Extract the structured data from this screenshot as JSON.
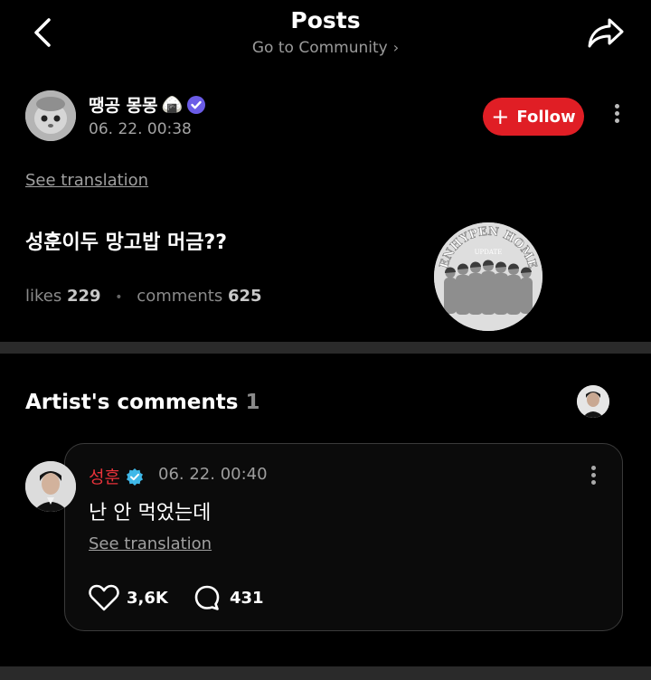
{
  "header": {
    "title": "Posts",
    "subtitle": "Go to Community"
  },
  "post": {
    "author": {
      "name": "땡공 몽몽",
      "badge_emoji": "🍙",
      "date": "06. 22. 00:38"
    },
    "follow_label": "Follow",
    "see_translation": "See translation",
    "text": "성훈이두 망고밥 머금??",
    "likes_label": "likes",
    "likes": "229",
    "comments_label": "comments",
    "comments": "625",
    "thumbnail_lines": [
      "ENHYPEN HOME",
      "UPDATE"
    ]
  },
  "artist_comments": {
    "heading": "Artist's comments",
    "count": "1",
    "comment": {
      "author": "성훈",
      "date": "06. 22. 00:40",
      "text": "난 안 먹었는데",
      "see_translation": "See translation",
      "likes": "3,6K",
      "replies": "431"
    }
  },
  "icons": {
    "back": "chevron-left-icon",
    "share": "share-icon",
    "more": "more-vertical-icon",
    "verified": "verified-badge-icon",
    "heart": "heart-icon",
    "comment": "comment-bubble-icon"
  },
  "colors": {
    "follow": "#e01e25",
    "artist_name": "#e8323a",
    "verified": "#3fb8e8"
  }
}
